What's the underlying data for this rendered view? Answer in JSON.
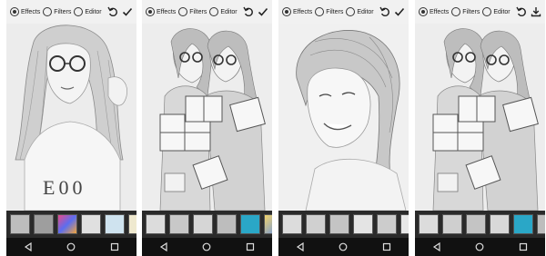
{
  "screens": [
    {
      "options": [
        {
          "label": "Effects",
          "selected": true
        },
        {
          "label": "Filters",
          "selected": false
        },
        {
          "label": "Editor",
          "selected": false
        }
      ],
      "action_icon": "check-icon",
      "shirt_text": "E00",
      "thumbnails": [
        "#bdbdbd",
        "#9e9e9e",
        "#d04a8c",
        "#e0e0e0",
        "#cfe3ef",
        "#efe9cf"
      ]
    },
    {
      "options": [
        {
          "label": "Effects",
          "selected": true
        },
        {
          "label": "Filters",
          "selected": false
        },
        {
          "label": "Editor",
          "selected": false
        }
      ],
      "action_icon": "check-icon",
      "thumbnails": [
        "#dcdcdc",
        "#c8c8c8",
        "#d6d6d6",
        "#2aa7c7",
        "#bdbdbd",
        "#f3d36a"
      ]
    },
    {
      "options": [
        {
          "label": "Effects",
          "selected": true
        },
        {
          "label": "Filters",
          "selected": false
        },
        {
          "label": "Editor",
          "selected": false
        }
      ],
      "action_icon": "check-icon",
      "thumbnails": [
        "#dcdcdc",
        "#d0d0d0",
        "#c4c4c4",
        "#e4e4e4",
        "#cccccc",
        "#e8e8e8"
      ]
    },
    {
      "options": [
        {
          "label": "Effects",
          "selected": true
        },
        {
          "label": "Filters",
          "selected": false
        },
        {
          "label": "Editor",
          "selected": false
        }
      ],
      "action_icon": "download-icon",
      "thumbnails": [
        "#dcdcdc",
        "#cfcfcf",
        "#c4c4c4",
        "#d8d8d8",
        "#2aa7c7",
        "#bdbdbd"
      ]
    }
  ]
}
